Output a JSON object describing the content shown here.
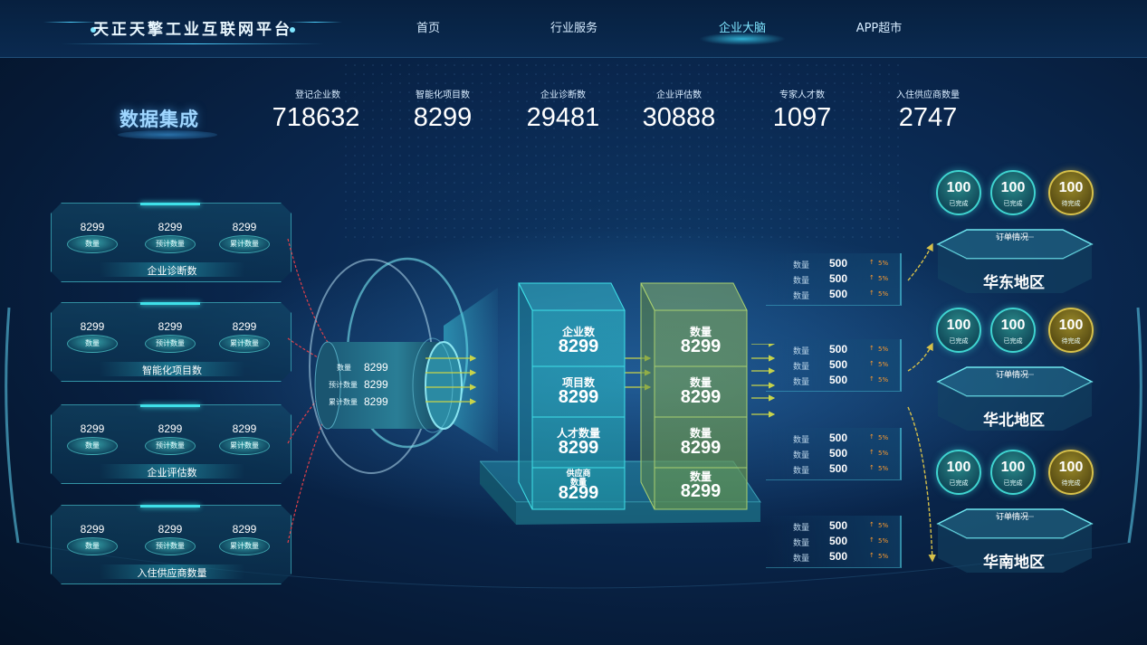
{
  "header": {
    "title": "天正天擎工业互联网平台",
    "nav": [
      {
        "label": "首页"
      },
      {
        "label": "行业服务"
      },
      {
        "label": "企业大脑",
        "active": true
      },
      {
        "label": "APP超市"
      }
    ]
  },
  "section": {
    "title": "数据集成"
  },
  "stats": [
    {
      "label": "登记企业数",
      "value": "718632"
    },
    {
      "label": "智能化项目数",
      "value": "8299"
    },
    {
      "label": "企业诊断数",
      "value": "29481"
    },
    {
      "label": "企业评估数",
      "value": "30888"
    },
    {
      "label": "专家人才数",
      "value": "1097"
    },
    {
      "label": "入住供应商数量",
      "value": "2747"
    }
  ],
  "left_panels": [
    {
      "name": "企业诊断数",
      "items": [
        {
          "value": "8299",
          "label": "数量"
        },
        {
          "value": "8299",
          "label": "预计数量"
        },
        {
          "value": "8299",
          "label": "累计数量"
        }
      ]
    },
    {
      "name": "智能化项目数",
      "items": [
        {
          "value": "8299",
          "label": "数量"
        },
        {
          "value": "8299",
          "label": "预计数量"
        },
        {
          "value": "8299",
          "label": "累计数量"
        }
      ]
    },
    {
      "name": "企业评估数",
      "items": [
        {
          "value": "8299",
          "label": "数量"
        },
        {
          "value": "8299",
          "label": "预计数量"
        },
        {
          "value": "8299",
          "label": "累计数量"
        }
      ]
    },
    {
      "name": "入住供应商数量",
      "items": [
        {
          "value": "8299",
          "label": "数量"
        },
        {
          "value": "8299",
          "label": "预计数量"
        },
        {
          "value": "8299",
          "label": "累计数量"
        }
      ]
    }
  ],
  "cylinder": {
    "rows": [
      {
        "label": "数量",
        "value": "8299"
      },
      {
        "label": "预计数量",
        "value": "8299"
      },
      {
        "label": "累计数量",
        "value": "8299"
      }
    ]
  },
  "column_a": [
    {
      "label": "企业数",
      "value": "8299"
    },
    {
      "label": "项目数",
      "value": "8299"
    },
    {
      "label": "人才数量",
      "value": "8299"
    },
    {
      "label": "供应商\n数量",
      "label_line1": "供应商",
      "label_line2": "数量",
      "value": "8299"
    }
  ],
  "column_b": [
    {
      "label": "数量",
      "value": "8299"
    },
    {
      "label": "数量",
      "value": "8299"
    },
    {
      "label": "数量",
      "value": "8299"
    },
    {
      "label": "数量",
      "value": "8299"
    }
  ],
  "mini_boxes": [
    {
      "rows": [
        {
          "label": "数量",
          "value": "500",
          "pct": "5%"
        },
        {
          "label": "数量",
          "value": "500",
          "pct": "5%"
        },
        {
          "label": "数量",
          "value": "500",
          "pct": "5%"
        }
      ]
    },
    {
      "rows": [
        {
          "label": "数量",
          "value": "500",
          "pct": "5%"
        },
        {
          "label": "数量",
          "value": "500",
          "pct": "5%"
        },
        {
          "label": "数量",
          "value": "500",
          "pct": "5%"
        }
      ]
    },
    {
      "rows": [
        {
          "label": "数量",
          "value": "500",
          "pct": "5%"
        },
        {
          "label": "数量",
          "value": "500",
          "pct": "5%"
        },
        {
          "label": "数量",
          "value": "500",
          "pct": "5%"
        }
      ]
    },
    {
      "rows": [
        {
          "label": "数量",
          "value": "500",
          "pct": "5%"
        },
        {
          "label": "数量",
          "value": "500",
          "pct": "5%"
        },
        {
          "label": "数量",
          "value": "500",
          "pct": "5%"
        }
      ]
    }
  ],
  "regions": [
    {
      "name": "华东地区",
      "order_label": "订单情况",
      "circles": [
        {
          "value": "100",
          "label": "已完成",
          "status": "done"
        },
        {
          "value": "100",
          "label": "已完成",
          "status": "done"
        },
        {
          "value": "100",
          "label": "待完成",
          "status": "pending"
        }
      ]
    },
    {
      "name": "华北地区",
      "order_label": "订单情况",
      "circles": [
        {
          "value": "100",
          "label": "已完成",
          "status": "done"
        },
        {
          "value": "100",
          "label": "已完成",
          "status": "done"
        },
        {
          "value": "100",
          "label": "待完成",
          "status": "pending"
        }
      ]
    },
    {
      "name": "华南地区",
      "order_label": "订单情况",
      "circles": [
        {
          "value": "100",
          "label": "已完成",
          "status": "done"
        },
        {
          "value": "100",
          "label": "已完成",
          "status": "done"
        },
        {
          "value": "100",
          "label": "待完成",
          "status": "pending"
        }
      ]
    }
  ],
  "colors": {
    "accent": "#3fe0e8",
    "pending": "#d6c04a",
    "arrow": "#c8d44a",
    "link_red": "#e0404a",
    "pct": "#ff9b2e"
  }
}
